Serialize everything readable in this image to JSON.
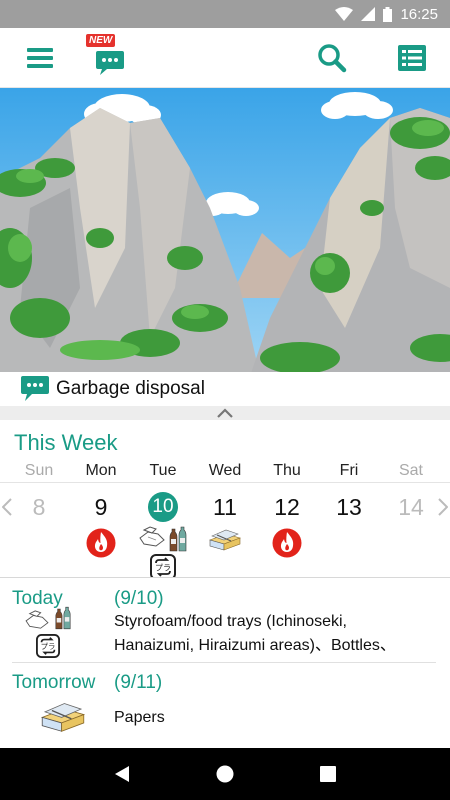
{
  "status_bar": {
    "time": "16:25"
  },
  "app_bar": {
    "new_badge": "NEW",
    "icons": [
      "menu-icon",
      "chat-icon",
      "search-icon",
      "list-icon"
    ],
    "accent_color": "#1a9b86"
  },
  "notice": {
    "label": "Garbage disposal"
  },
  "week": {
    "title": "This Week",
    "days": [
      {
        "name": "Sun",
        "date": "8",
        "muted": true,
        "icons": []
      },
      {
        "name": "Mon",
        "date": "9",
        "muted": false,
        "icons": [
          "fire-icon"
        ]
      },
      {
        "name": "Tue",
        "date": "10",
        "today": true,
        "icons": [
          "styrofoam-icon",
          "bottles-icon",
          "recycle-icon"
        ]
      },
      {
        "name": "Wed",
        "date": "11",
        "muted": false,
        "icons": [
          "papers-icon"
        ]
      },
      {
        "name": "Thu",
        "date": "12",
        "muted": false,
        "icons": [
          "fire-icon"
        ]
      },
      {
        "name": "Fri",
        "date": "13",
        "muted": false,
        "icons": []
      },
      {
        "name": "Sat",
        "date": "14",
        "muted": true,
        "icons": []
      }
    ]
  },
  "today": {
    "label": "Today",
    "date": "(9/10)",
    "line1": "Styrofoam/food trays (Ichinoseki,",
    "line2": "Hanaizumi, Hiraizumi areas)、Bottles、"
  },
  "tomorrow": {
    "label": "Tomorrow",
    "date": "(9/11)",
    "text": "Papers"
  }
}
